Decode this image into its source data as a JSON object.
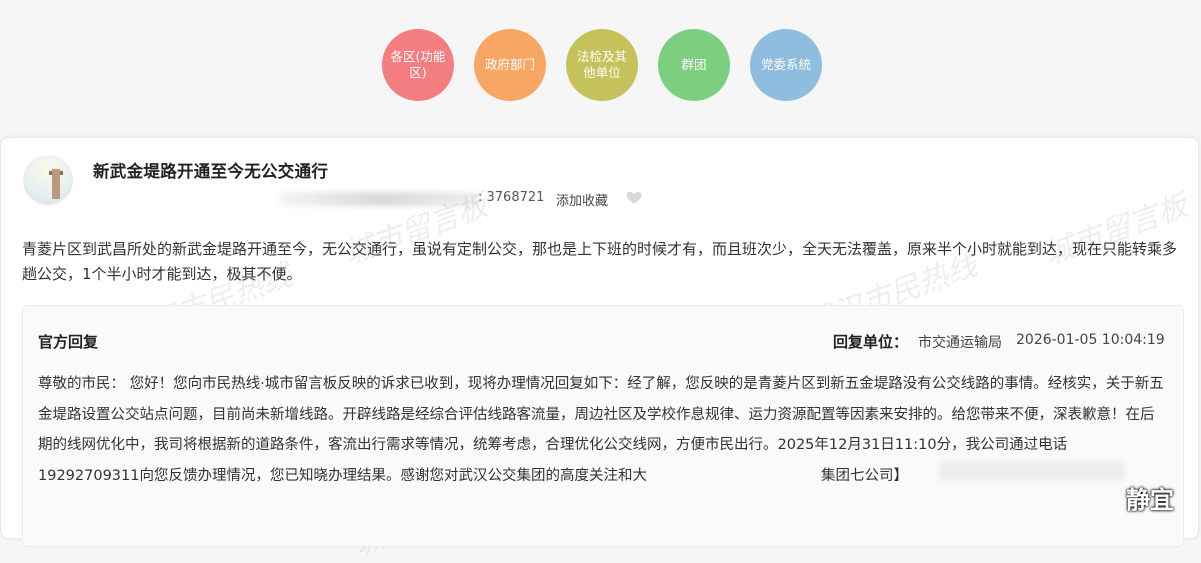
{
  "categories": [
    {
      "label": "各区(功能区)",
      "color": "#f47d7f"
    },
    {
      "label": "政府部门",
      "color": "#f8a663"
    },
    {
      "label": "法检及其他单位",
      "color": "#c5c15b"
    },
    {
      "label": "群团",
      "color": "#7ccf7f"
    },
    {
      "label": "党委系统",
      "color": "#8fbde0"
    }
  ],
  "post": {
    "title": "新武金堤路开通至今无公交通行",
    "id_text": ": 3768721",
    "favorite_label": "添加收藏",
    "content": "青菱片区到武昌所处的新武金堤路开通至今，无公交通行，虽说有定制公交，那也是上下班的时候才有，而且班次少，全天无法覆盖，原来半个小时就能到达，现在只能转乘多趟公交，1个半小时才能到达，极其不便。"
  },
  "reply": {
    "title": "官方回复",
    "unit_label": "回复单位：",
    "unit": "市交通运输局",
    "time": "2026-01-05 10:04:19",
    "text": "尊敬的市民： 您好！您向市民热线·城市留言板反映的诉求已收到，现将办理情况回复如下：经了解，您反映的是青菱片区到新五金堤路没有公交线路的事情。经核实，关于新五金堤路设置公交站点问题，目前尚未新增线路。开辟线路是经综合评估线路客流量，周边社区及学校作息规律、运力资源配置等因素来安排的。给您带来不便，深表歉意！在后期的线网优化中，我司将根据新的道路条件，客流出行需求等情况，统筹考虑，合理优化公交线网，方便市民出行。2025年12月31日11:10分，我公司通过电话19292709311向您反馈办理情况，您已知晓办理结果。感谢您对武汉公交集团的高度关注和大　　　　　　　　　　　　集团七公司】"
  },
  "watermarks": [
    "城市留言板",
    "武汉市民热线",
    "城市留言板",
    "城市留言板"
  ],
  "corner_stamp": "静宜"
}
